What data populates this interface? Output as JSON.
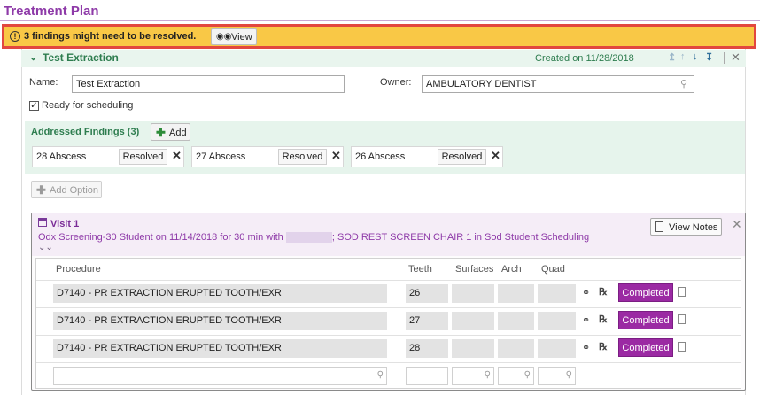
{
  "page": {
    "title": "Treatment Plan"
  },
  "banner": {
    "icon": "warning-circle-icon",
    "text": "3 findings might need to be resolved.",
    "view_label": "View",
    "bg_color": "#f9c846",
    "border_color": "#e2473f"
  },
  "plan": {
    "name_heading": "Test Extraction",
    "created": "Created on 11/28/2018",
    "name_label": "Name:",
    "name_value": "Test Extraction",
    "owner_label": "Owner:",
    "owner_value": "AMBULATORY DENTIST",
    "ready_label": "Ready for scheduling",
    "ready_checked": true
  },
  "findings": {
    "title": "Addressed Findings (3)",
    "add_label": "Add",
    "items": [
      {
        "label": "28 Abscess",
        "status": "Resolved"
      },
      {
        "label": "27 Abscess",
        "status": "Resolved"
      },
      {
        "label": "26 Abscess",
        "status": "Resolved"
      }
    ]
  },
  "add_option_label": "Add Option",
  "visit": {
    "title": "Visit 1",
    "subtitle_pre": "Odx Screening-30 Student on 11/14/2018 for 30 min with",
    "subtitle_post": "; SOD REST SCREEN CHAIR 1 in Sod Student Scheduling",
    "notes_label": "View Notes",
    "columns": {
      "procedure": "Procedure",
      "teeth": "Teeth",
      "surfaces": "Surfaces",
      "arch": "Arch",
      "quad": "Quad"
    },
    "rows": [
      {
        "procedure": "D7140 - PR EXTRACTION ERUPTED TOOTH/EXR",
        "teeth": "26",
        "status": "Completed"
      },
      {
        "procedure": "D7140 - PR EXTRACTION ERUPTED TOOTH/EXR",
        "teeth": "27",
        "status": "Completed"
      },
      {
        "procedure": "D7140 - PR EXTRACTION ERUPTED TOOTH/EXR",
        "teeth": "28",
        "status": "Completed"
      }
    ]
  },
  "colors": {
    "title": "#8e3aa8",
    "green_text": "#2e7d4f",
    "completed_bg": "#9b2aa3"
  }
}
